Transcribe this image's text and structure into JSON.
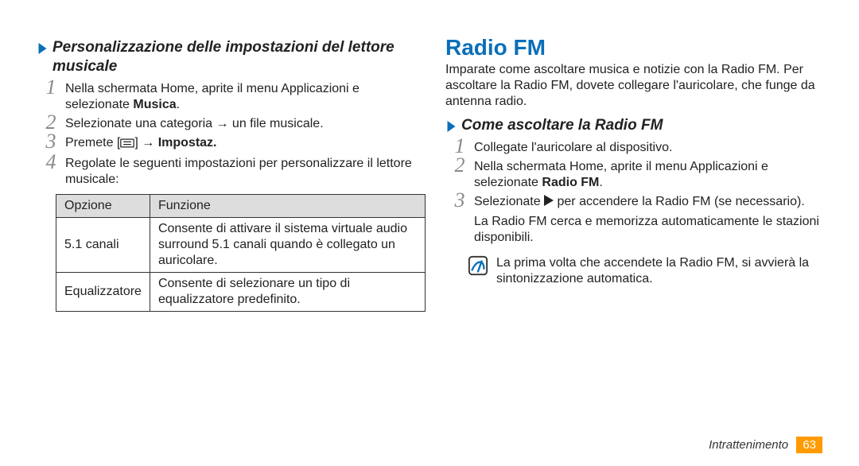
{
  "left": {
    "heading": "Personalizzazione delle impostazioni del lettore musicale",
    "steps": {
      "s1_a": "Nella schermata Home, aprite il menu Applicazioni e selezionate ",
      "s1_b": "Musica",
      "s1_c": ".",
      "s2": "Selezionate una categoria → un file musicale.",
      "s3_a": "Premete [",
      "s3_b": "] → ",
      "s3_c": "Impostaz.",
      "s4": "Regolate le seguenti impostazioni per personalizzare il lettore musicale:"
    },
    "table": {
      "head_opt": "Opzione",
      "head_func": "Funzione",
      "rows": [
        {
          "opt": "5.1 canali",
          "func": "Consente di attivare il sistema virtuale audio surround 5.1 canali quando è collegato un auricolare."
        },
        {
          "opt": "Equalizzatore",
          "func": "Consente di selezionare un tipo di equalizzatore predefinito."
        }
      ]
    }
  },
  "right": {
    "title": "Radio FM",
    "intro": "Imparate come ascoltare musica e notizie con la Radio FM. Per ascoltare la Radio FM, dovete collegare l'auricolare, che funge da antenna radio.",
    "heading": "Come ascoltare la Radio FM",
    "steps": {
      "s1": "Collegate l'auricolare al dispositivo.",
      "s2_a": "Nella schermata Home, aprite il menu Applicazioni e selezionate ",
      "s2_b": "Radio FM",
      "s2_c": ".",
      "s3_a": "Selezionate ",
      "s3_b": " per accendere la Radio FM (se necessario).",
      "s3_cont": "La Radio FM cerca e memorizza automaticamente le stazioni disponibili."
    },
    "note": "La prima volta che accendete la Radio FM, si avvierà la sintonizzazione automatica."
  },
  "footer": {
    "section": "Intrattenimento",
    "page": "63"
  }
}
